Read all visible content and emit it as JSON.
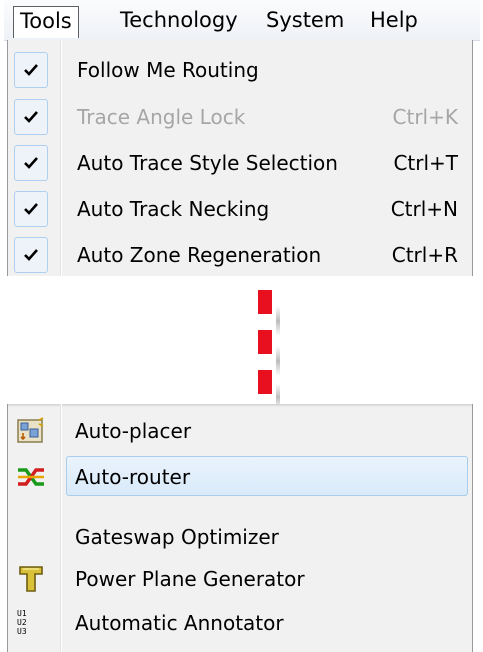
{
  "menubar": {
    "titles": [
      "Tools",
      "Technology",
      "System",
      "Help"
    ],
    "active": "Tools"
  },
  "top_menu": {
    "items": [
      {
        "label": "Follow Me Routing",
        "shortcut": "",
        "checked": true,
        "enabled": true
      },
      {
        "label": "Trace Angle Lock",
        "shortcut": "Ctrl+K",
        "checked": true,
        "enabled": false
      },
      {
        "label": "Auto Trace Style Selection",
        "shortcut": "Ctrl+T",
        "checked": true,
        "enabled": true
      },
      {
        "label": "Auto Track Necking",
        "shortcut": "Ctrl+N",
        "checked": true,
        "enabled": true
      },
      {
        "label": "Auto Zone Regeneration",
        "shortcut": "Ctrl+R",
        "checked": true,
        "enabled": true
      }
    ]
  },
  "bottom_menu": {
    "items": [
      {
        "label": "Auto-placer",
        "icon": "auto-placer-icon"
      },
      {
        "label": "Auto-router",
        "icon": "auto-router-icon",
        "highlighted": true
      },
      {
        "label": "Gateswap Optimizer",
        "icon": ""
      },
      {
        "label": "Power Plane Generator",
        "icon": "power-plane-icon"
      },
      {
        "label": "Automatic Annotator",
        "icon": "annotator-icon",
        "icon_text": [
          "U1",
          "U2",
          "U3"
        ]
      }
    ]
  },
  "colors": {
    "break_dash": "#e8101e",
    "menu_bg": "#f1f1f1",
    "highlight_border": "#a9cdec",
    "disabled_text": "#a6a6a6"
  }
}
